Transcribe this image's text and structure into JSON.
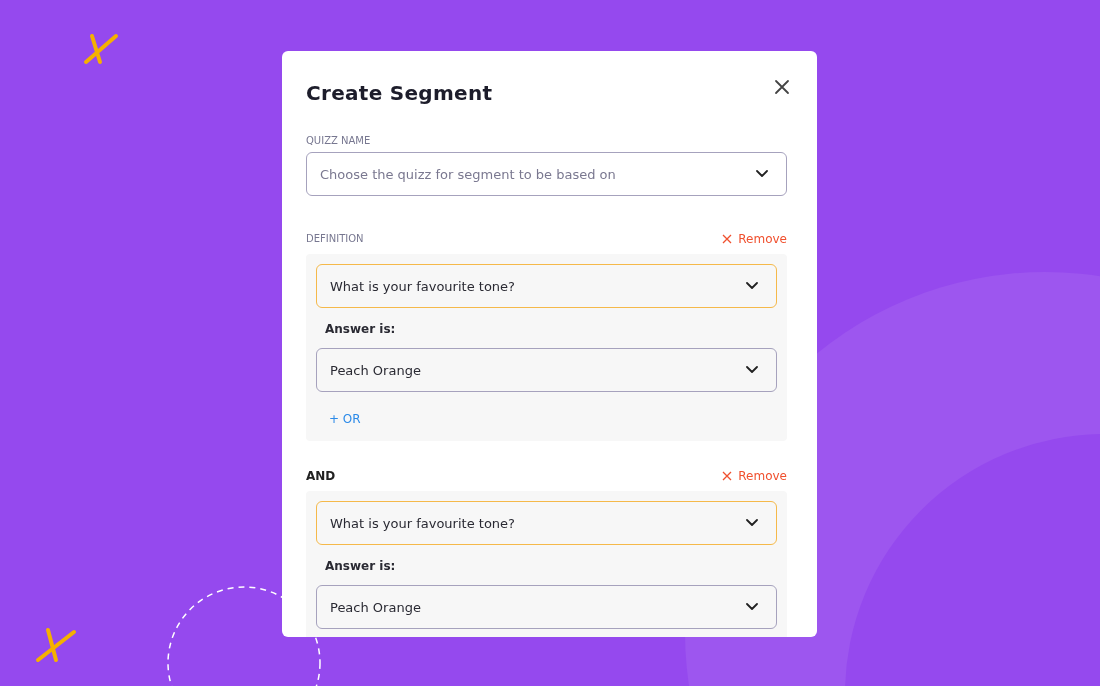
{
  "modal": {
    "title": "Create Segment",
    "quiz_field": {
      "label": "QUIZZ NAME",
      "placeholder": "Choose the quizz for segment to be based on"
    },
    "conditions": [
      {
        "kind": "definition",
        "label": "DEFINITION",
        "remove": "Remove",
        "question": "What is your favourite tone?",
        "answer_label": "Answer is:",
        "answer": "Peach Orange",
        "or_button": "+ OR"
      },
      {
        "kind": "and",
        "label": "AND",
        "remove": "Remove",
        "question": "What is your favourite tone?",
        "answer_label": "Answer is:",
        "answer": "Peach Orange"
      }
    ]
  }
}
